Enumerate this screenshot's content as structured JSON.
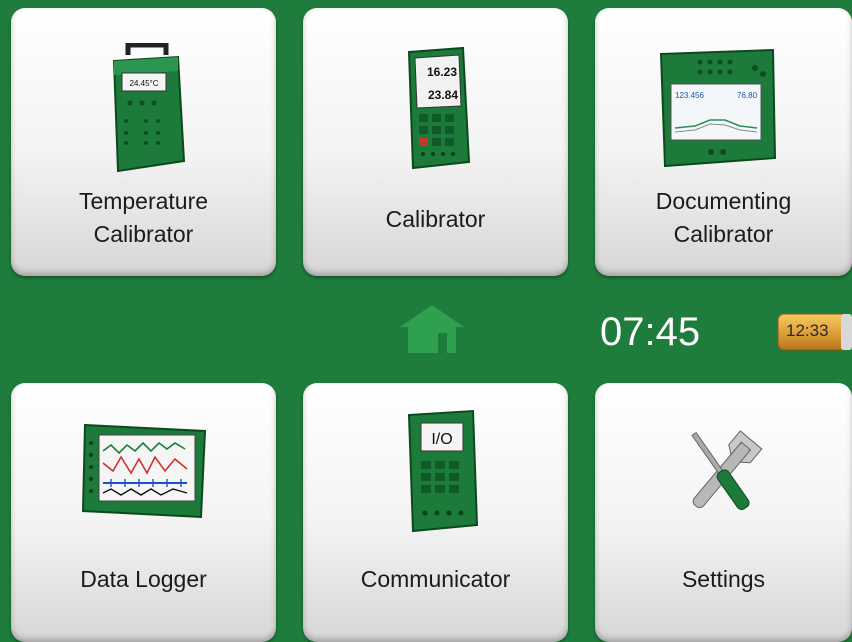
{
  "tiles": [
    {
      "label": "Temperature\nCalibrator",
      "icon": "temperature-calibrator-icon"
    },
    {
      "label": "Calibrator",
      "icon": "calibrator-icon"
    },
    {
      "label": "Documenting\nCalibrator",
      "icon": "documenting-calibrator-icon"
    },
    {
      "label": "Data Logger",
      "icon": "data-logger-icon"
    },
    {
      "label": "Communicator",
      "icon": "communicator-icon"
    },
    {
      "label": "Settings",
      "icon": "settings-tools-icon"
    }
  ],
  "devices": {
    "temp_display": "24.45°C",
    "calib_top": "16.23",
    "calib_bottom": "23.84",
    "doc_value_1": "123.456",
    "doc_value_2": "76.80",
    "comm_display": "I/O"
  },
  "status_bar": {
    "home_icon": "home-icon",
    "time": "07:45",
    "battery_time": "12:33"
  },
  "colors": {
    "brand_green": "#1e7d3c",
    "home_icon_green": "#2ea04e",
    "battery_orange": "#e0a13a"
  }
}
